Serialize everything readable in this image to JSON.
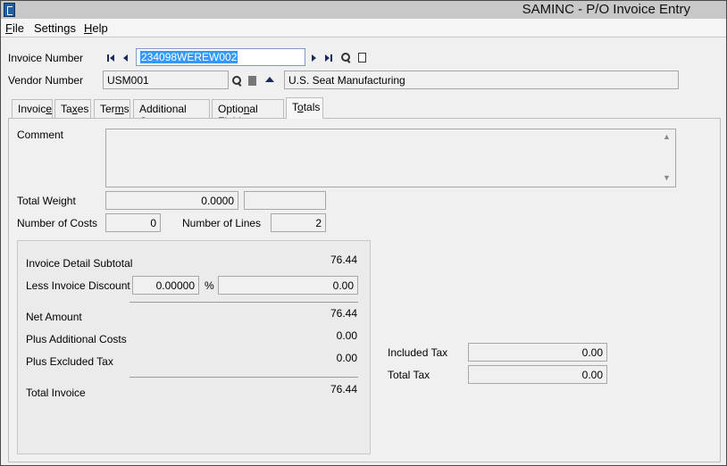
{
  "window": {
    "title": "SAMINC - P/O Invoice Entry"
  },
  "menu": [
    {
      "label": "File",
      "accel": "F",
      "rest": "ile"
    },
    {
      "label": "Settings",
      "accel": "",
      "rest": "Settings"
    },
    {
      "label": "Help",
      "accel": "H",
      "rest": "elp"
    }
  ],
  "header": {
    "invoice_number_label": "Invoice Number",
    "invoice_number_value": "234098WEREW002",
    "vendor_number_label": "Vendor Number",
    "vendor_number_value": "USM001",
    "vendor_name": "U.S. Seat Manufacturing"
  },
  "tabs": [
    {
      "pre": "Invoic",
      "u": "e",
      "post": ""
    },
    {
      "pre": "Ta",
      "u": "x",
      "post": "es"
    },
    {
      "pre": "Ter",
      "u": "m",
      "post": "s"
    },
    {
      "pre": "Additional Costs",
      "u": "",
      "post": ""
    },
    {
      "pre": "Optio",
      "u": "n",
      "post": "al Fields"
    },
    {
      "pre": "T",
      "u": "o",
      "post": "tals"
    }
  ],
  "totals_tab": {
    "comment_label": "Comment",
    "comment_value": "",
    "total_weight_label": "Total Weight",
    "total_weight_value": "0.0000",
    "total_weight_unit": "",
    "number_of_costs_label": "Number of Costs",
    "number_of_costs_value": "0",
    "number_of_lines_label": "Number of Lines",
    "number_of_lines_value": "2",
    "invoice_detail_subtotal_label": "Invoice Detail Subtotal",
    "invoice_detail_subtotal_value": "76.44",
    "less_invoice_discount_label": "Less Invoice Discount",
    "discount_percent_value": "0.00000",
    "percent_sign": "%",
    "discount_amount_value": "0.00",
    "net_amount_label": "Net Amount",
    "net_amount_value": "76.44",
    "plus_additional_costs_label": "Plus Additional Costs",
    "plus_additional_costs_value": "0.00",
    "plus_excluded_tax_label": "Plus Excluded Tax",
    "plus_excluded_tax_value": "0.00",
    "total_invoice_label": "Total Invoice",
    "total_invoice_value": "76.44",
    "included_tax_label": "Included Tax",
    "included_tax_value": "0.00",
    "total_tax_label": "Total Tax",
    "total_tax_value": "0.00"
  }
}
